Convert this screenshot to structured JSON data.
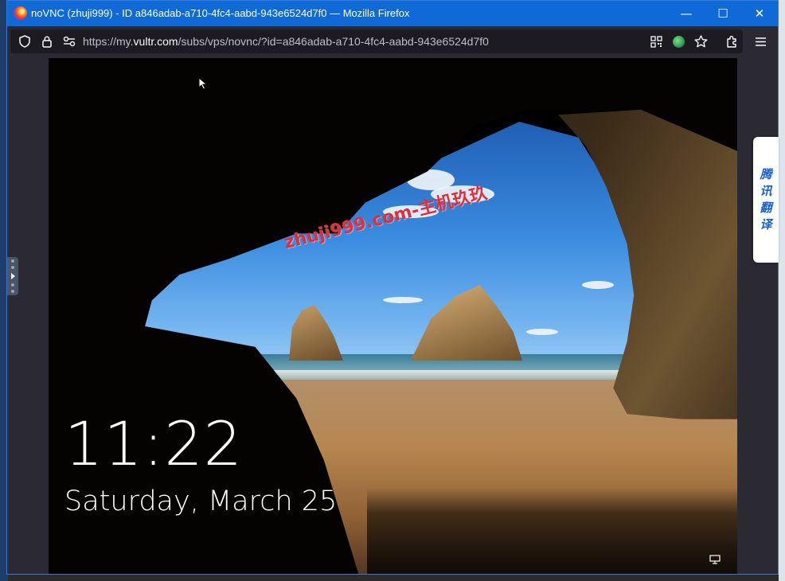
{
  "window": {
    "title": "noVNC (zhuji999) - ID a846adab-a710-4fc4-aabd-943e6524d7f0 — Mozilla Firefox",
    "min_glyph": "—",
    "max_glyph": "☐",
    "close_glyph": "✕"
  },
  "urlbar": {
    "prefix": "https://my.",
    "domain": "vultr.com",
    "path": "/subs/vps/novnc/?id=a846adab-a710-4fc4-aabd-943e6524d7f0"
  },
  "lockscreen": {
    "time": "11:22",
    "date": "Saturday, March 25"
  },
  "watermark": "zhuji999.com-主机玖玖",
  "translate_panel": [
    "腾",
    "讯",
    "翻",
    "译"
  ],
  "icons": {
    "shield": "shield-icon",
    "lock": "lock-icon",
    "permissions": "permissions-icon",
    "qr": "qr-code-icon",
    "extension": "globe-extension-icon",
    "bookmark": "star-icon",
    "extensions": "puzzle-icon",
    "menu": "hamburger-menu-icon",
    "network": "network-icon"
  }
}
